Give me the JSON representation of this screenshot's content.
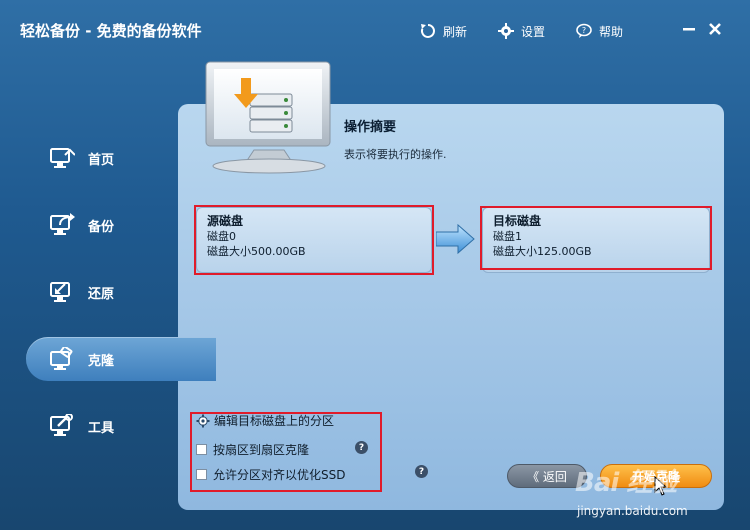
{
  "app": {
    "title": "轻松备份 - 免费的备份软件"
  },
  "toolbar": {
    "refresh": "刷新",
    "settings": "设置",
    "help": "帮助"
  },
  "sidebar": {
    "items": [
      {
        "label": "首页",
        "icon": "home-icon"
      },
      {
        "label": "备份",
        "icon": "backup-icon"
      },
      {
        "label": "还原",
        "icon": "restore-icon"
      },
      {
        "label": "克隆",
        "icon": "clone-icon",
        "active": true
      },
      {
        "label": "工具",
        "icon": "tools-icon"
      }
    ]
  },
  "summary": {
    "title": "操作摘要",
    "subtitle": "表示将要执行的操作."
  },
  "source": {
    "header": "源磁盘",
    "disk": "磁盘0",
    "size": "磁盘大小500.00GB"
  },
  "target": {
    "header": "目标磁盘",
    "disk": "磁盘1",
    "size": "磁盘大小125.00GB"
  },
  "options": {
    "edit_partitions": "编辑目标磁盘上的分区",
    "sector_clone": "按扇区到扇区克隆",
    "align_ssd": "允许分区对齐以优化SSD",
    "help_mark": "?"
  },
  "buttons": {
    "back": "《 返回",
    "start": "开始克隆"
  },
  "watermark": {
    "logo": "Bai 经验",
    "url": "jingyan.baidu.com"
  },
  "colors": {
    "accent": "#f08c12",
    "highlight": "#e01b2a"
  }
}
